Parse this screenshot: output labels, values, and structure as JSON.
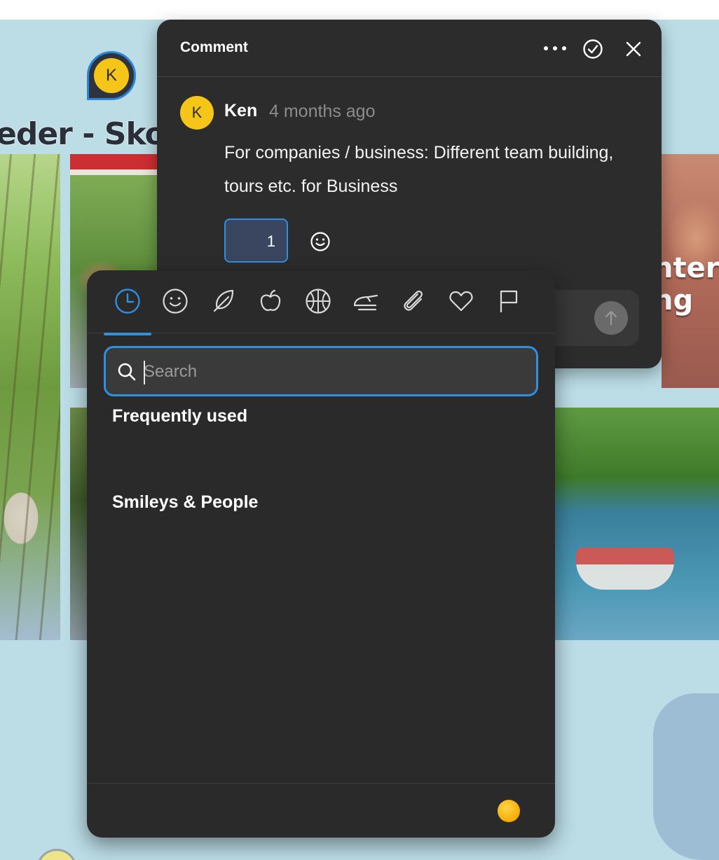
{
  "board": {
    "title_fragment": "eder - Skole",
    "photo_text": "nter ng",
    "avatar_initial": "K"
  },
  "comment": {
    "header_title": "Comment",
    "author_initial": "K",
    "author": "Ken",
    "time": "4 months ago",
    "body": "For companies / business: Different team building, tours etc. for Business",
    "reaction_count": "1"
  },
  "picker": {
    "categories": [
      "recent",
      "smileys",
      "nature",
      "food",
      "activities",
      "travel",
      "objects",
      "symbols",
      "flags"
    ],
    "active_category": "recent",
    "search_placeholder": "Search",
    "search_value": "",
    "sections": [
      "Frequently used",
      "Smileys & People"
    ]
  },
  "colors": {
    "accent": "#2f8fe0",
    "panel": "#2c2c2c",
    "picker": "#2a2a2a",
    "avatar": "#f5c518",
    "board": "#bcdde6"
  },
  "icons": {
    "more": "more-horizontal-icon",
    "resolve": "check-circle-icon",
    "close": "close-icon",
    "add_reaction": "smiley-icon",
    "send": "arrow-up-icon",
    "search": "search-icon"
  }
}
